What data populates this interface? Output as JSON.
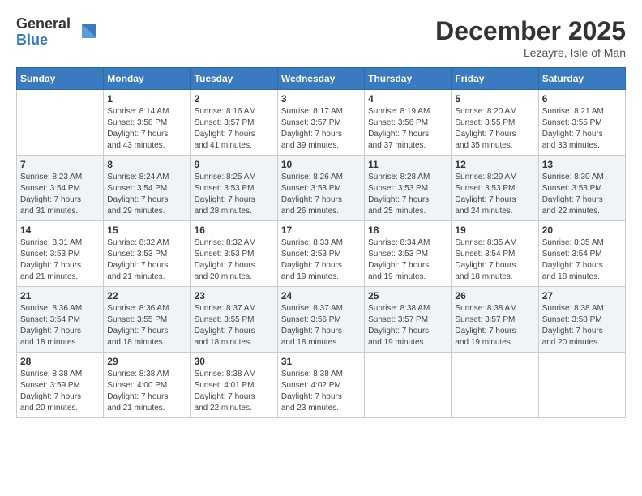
{
  "logo": {
    "general": "General",
    "blue": "Blue"
  },
  "header": {
    "month": "December 2025",
    "location": "Lezayre, Isle of Man"
  },
  "days_of_week": [
    "Sunday",
    "Monday",
    "Tuesday",
    "Wednesday",
    "Thursday",
    "Friday",
    "Saturday"
  ],
  "weeks": [
    [
      {
        "day": "",
        "info": ""
      },
      {
        "day": "1",
        "info": "Sunrise: 8:14 AM\nSunset: 3:58 PM\nDaylight: 7 hours\nand 43 minutes."
      },
      {
        "day": "2",
        "info": "Sunrise: 8:16 AM\nSunset: 3:57 PM\nDaylight: 7 hours\nand 41 minutes."
      },
      {
        "day": "3",
        "info": "Sunrise: 8:17 AM\nSunset: 3:57 PM\nDaylight: 7 hours\nand 39 minutes."
      },
      {
        "day": "4",
        "info": "Sunrise: 8:19 AM\nSunset: 3:56 PM\nDaylight: 7 hours\nand 37 minutes."
      },
      {
        "day": "5",
        "info": "Sunrise: 8:20 AM\nSunset: 3:55 PM\nDaylight: 7 hours\nand 35 minutes."
      },
      {
        "day": "6",
        "info": "Sunrise: 8:21 AM\nSunset: 3:55 PM\nDaylight: 7 hours\nand 33 minutes."
      }
    ],
    [
      {
        "day": "7",
        "info": "Sunrise: 8:23 AM\nSunset: 3:54 PM\nDaylight: 7 hours\nand 31 minutes."
      },
      {
        "day": "8",
        "info": "Sunrise: 8:24 AM\nSunset: 3:54 PM\nDaylight: 7 hours\nand 29 minutes."
      },
      {
        "day": "9",
        "info": "Sunrise: 8:25 AM\nSunset: 3:53 PM\nDaylight: 7 hours\nand 28 minutes."
      },
      {
        "day": "10",
        "info": "Sunrise: 8:26 AM\nSunset: 3:53 PM\nDaylight: 7 hours\nand 26 minutes."
      },
      {
        "day": "11",
        "info": "Sunrise: 8:28 AM\nSunset: 3:53 PM\nDaylight: 7 hours\nand 25 minutes."
      },
      {
        "day": "12",
        "info": "Sunrise: 8:29 AM\nSunset: 3:53 PM\nDaylight: 7 hours\nand 24 minutes."
      },
      {
        "day": "13",
        "info": "Sunrise: 8:30 AM\nSunset: 3:53 PM\nDaylight: 7 hours\nand 22 minutes."
      }
    ],
    [
      {
        "day": "14",
        "info": "Sunrise: 8:31 AM\nSunset: 3:53 PM\nDaylight: 7 hours\nand 21 minutes."
      },
      {
        "day": "15",
        "info": "Sunrise: 8:32 AM\nSunset: 3:53 PM\nDaylight: 7 hours\nand 21 minutes."
      },
      {
        "day": "16",
        "info": "Sunrise: 8:32 AM\nSunset: 3:53 PM\nDaylight: 7 hours\nand 20 minutes."
      },
      {
        "day": "17",
        "info": "Sunrise: 8:33 AM\nSunset: 3:53 PM\nDaylight: 7 hours\nand 19 minutes."
      },
      {
        "day": "18",
        "info": "Sunrise: 8:34 AM\nSunset: 3:53 PM\nDaylight: 7 hours\nand 19 minutes."
      },
      {
        "day": "19",
        "info": "Sunrise: 8:35 AM\nSunset: 3:54 PM\nDaylight: 7 hours\nand 18 minutes."
      },
      {
        "day": "20",
        "info": "Sunrise: 8:35 AM\nSunset: 3:54 PM\nDaylight: 7 hours\nand 18 minutes."
      }
    ],
    [
      {
        "day": "21",
        "info": "Sunrise: 8:36 AM\nSunset: 3:54 PM\nDaylight: 7 hours\nand 18 minutes."
      },
      {
        "day": "22",
        "info": "Sunrise: 8:36 AM\nSunset: 3:55 PM\nDaylight: 7 hours\nand 18 minutes."
      },
      {
        "day": "23",
        "info": "Sunrise: 8:37 AM\nSunset: 3:55 PM\nDaylight: 7 hours\nand 18 minutes."
      },
      {
        "day": "24",
        "info": "Sunrise: 8:37 AM\nSunset: 3:56 PM\nDaylight: 7 hours\nand 18 minutes."
      },
      {
        "day": "25",
        "info": "Sunrise: 8:38 AM\nSunset: 3:57 PM\nDaylight: 7 hours\nand 19 minutes."
      },
      {
        "day": "26",
        "info": "Sunrise: 8:38 AM\nSunset: 3:57 PM\nDaylight: 7 hours\nand 19 minutes."
      },
      {
        "day": "27",
        "info": "Sunrise: 8:38 AM\nSunset: 3:58 PM\nDaylight: 7 hours\nand 20 minutes."
      }
    ],
    [
      {
        "day": "28",
        "info": "Sunrise: 8:38 AM\nSunset: 3:59 PM\nDaylight: 7 hours\nand 20 minutes."
      },
      {
        "day": "29",
        "info": "Sunrise: 8:38 AM\nSunset: 4:00 PM\nDaylight: 7 hours\nand 21 minutes."
      },
      {
        "day": "30",
        "info": "Sunrise: 8:38 AM\nSunset: 4:01 PM\nDaylight: 7 hours\nand 22 minutes."
      },
      {
        "day": "31",
        "info": "Sunrise: 8:38 AM\nSunset: 4:02 PM\nDaylight: 7 hours\nand 23 minutes."
      },
      {
        "day": "",
        "info": ""
      },
      {
        "day": "",
        "info": ""
      },
      {
        "day": "",
        "info": ""
      }
    ]
  ]
}
